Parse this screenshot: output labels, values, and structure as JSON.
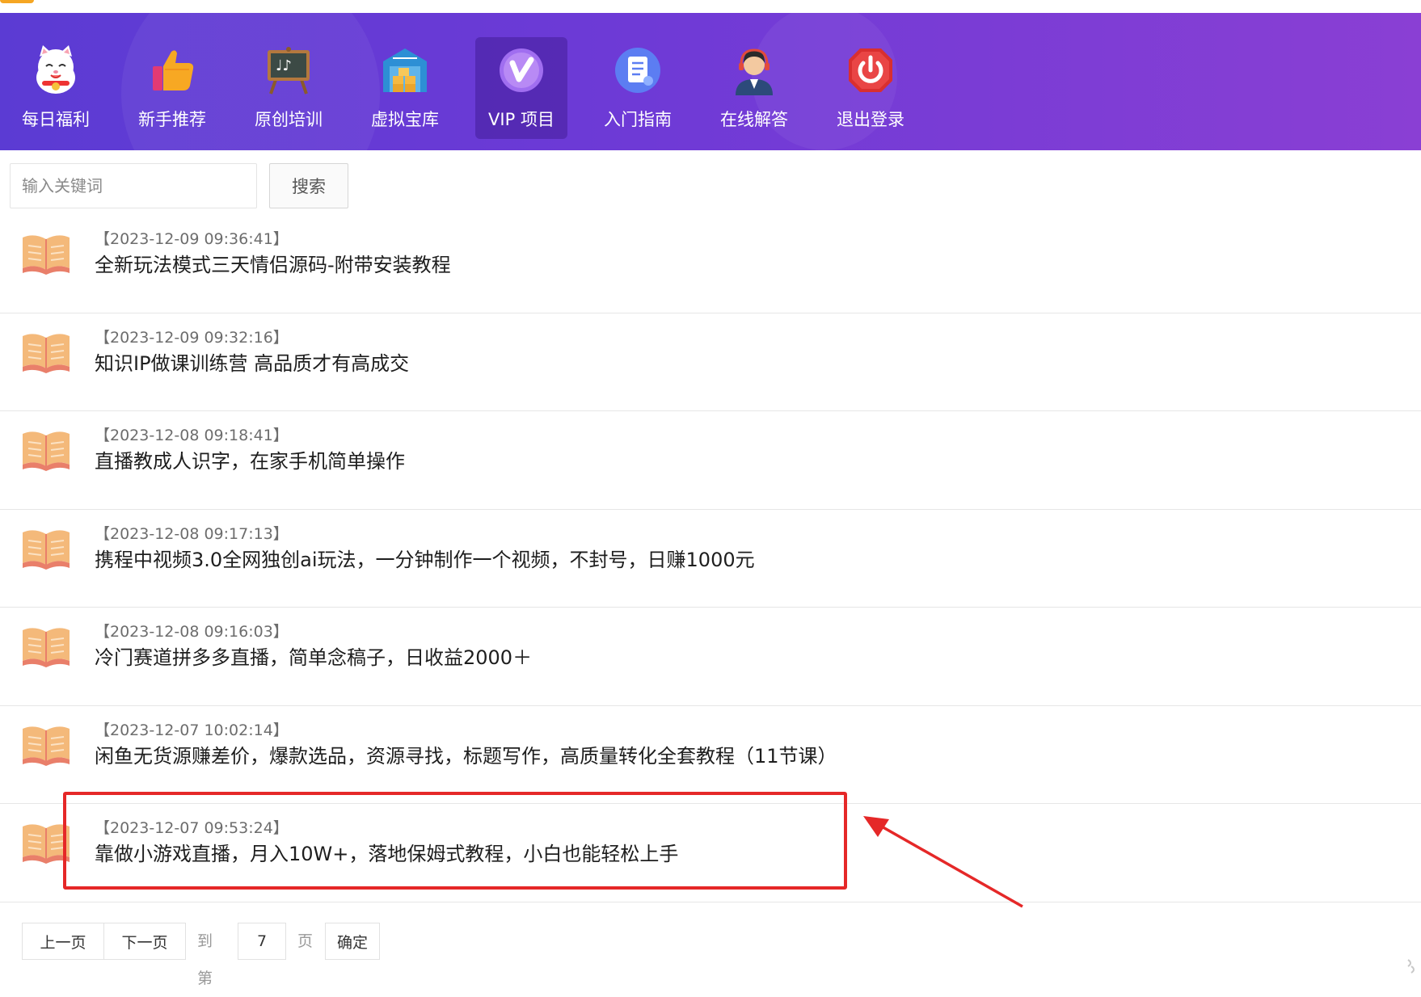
{
  "nav": {
    "items": [
      {
        "label": "每日福利",
        "icon": "lucky-cat-icon"
      },
      {
        "label": "新手推荐",
        "icon": "thumbs-up-icon"
      },
      {
        "label": "原创培训",
        "icon": "blackboard-icon"
      },
      {
        "label": "虚拟宝库",
        "icon": "warehouse-icon"
      },
      {
        "label": "VIP 项目",
        "icon": "vip-icon",
        "active": true
      },
      {
        "label": "入门指南",
        "icon": "document-icon"
      },
      {
        "label": "在线解答",
        "icon": "support-agent-icon"
      },
      {
        "label": "退出登录",
        "icon": "power-icon"
      }
    ]
  },
  "search": {
    "placeholder": "输入关键词",
    "value": "",
    "button_label": "搜索"
  },
  "list": {
    "items": [
      {
        "date": "【2023-12-09 09:36:41】",
        "title": "全新玩法模式三天情侣源码-附带安装教程"
      },
      {
        "date": "【2023-12-09 09:32:16】",
        "title": "知识IP做课训练营 高品质才有高成交"
      },
      {
        "date": "【2023-12-08 09:18:41】",
        "title": "直播教成人识字，在家手机简单操作"
      },
      {
        "date": "【2023-12-08 09:17:13】",
        "title": "携程中视频3.0全网独创ai玩法，一分钟制作一个视频，不封号，日赚1000元"
      },
      {
        "date": "【2023-12-08 09:16:03】",
        "title": "冷门赛道拼多多直播，简单念稿子，日收益2000＋"
      },
      {
        "date": "【2023-12-07 10:02:14】",
        "title": "闲鱼无货源赚差价，爆款选品，资源寻找，标题写作，高质量转化全套教程（11节课）"
      },
      {
        "date": "【2023-12-07 09:53:24】",
        "title": "靠做小游戏直播，月入10W+，落地保姆式教程，小白也能轻松上手",
        "highlighted": true
      }
    ]
  },
  "pager": {
    "prev_label": "上一页",
    "next_label": "下一页",
    "goto_prefix": "到第",
    "page_value": "7",
    "goto_suffix": "页",
    "confirm_label": "确定"
  },
  "colors": {
    "nav_gradient_start": "#5b3bd3",
    "nav_gradient_end": "#8a3fd4",
    "highlight": "#e52828",
    "book": "#f4b97a"
  }
}
